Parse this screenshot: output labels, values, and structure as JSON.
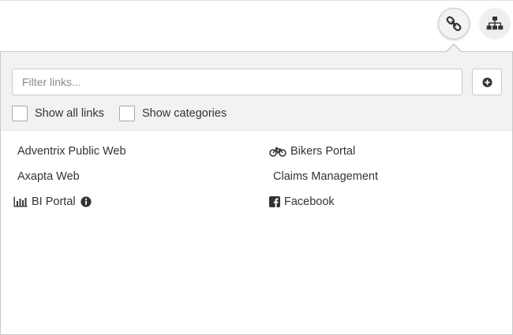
{
  "toolbar": {
    "links_button_icon": "link-icon",
    "sitemap_button_icon": "sitemap-icon"
  },
  "filter": {
    "placeholder": "Filter links...",
    "add_button_icon": "plus-circle-icon"
  },
  "options": {
    "show_all_links": "Show all links",
    "show_categories": "Show categories"
  },
  "links": [
    {
      "label": "Adventrix Public Web",
      "icon": null
    },
    {
      "label": "Bikers Portal",
      "icon": "bicycle-icon"
    },
    {
      "label": "Axapta Web",
      "icon": null
    },
    {
      "label": "Claims Management",
      "icon": null
    },
    {
      "label": "BI Portal",
      "icon": "bar-chart-icon",
      "info": true
    },
    {
      "label": "Facebook",
      "icon": "facebook-icon"
    }
  ],
  "colors": {
    "panel_background": "#f2f2f2",
    "border": "#c8c8c8",
    "text": "#333333"
  }
}
